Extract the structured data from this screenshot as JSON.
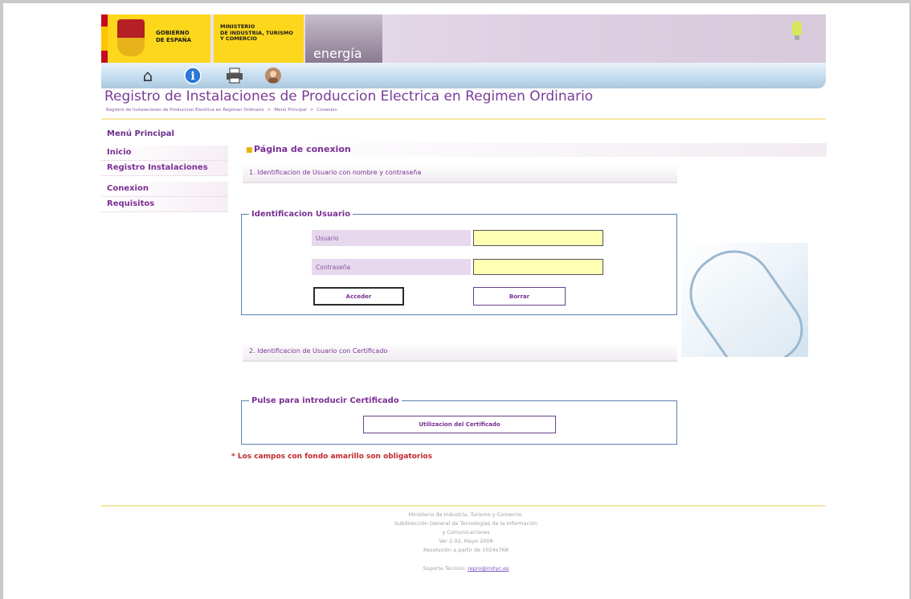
{
  "header": {
    "gobierno_line1": "GOBIERNO",
    "gobierno_line2": "DE ESPAÑA",
    "ministerio_line1": "MINISTERIO",
    "ministerio_line2": "DE INDUSTRIA, TURISMO",
    "ministerio_line3": "Y COMERCIO",
    "energia": "energía"
  },
  "toolbar_icons": [
    "home-icon",
    "info-icon",
    "print-icon",
    "user-photo-icon"
  ],
  "page_title": "Registro de Instalaciones de Produccion Electrica en Regimen Ordinario",
  "breadcrumb": {
    "item1": "Registro de Instalaciones de Produccion Electrica en Regimen Ordinario",
    "item2": "Menú Principal",
    "item3": "Conexion",
    "sep": ">"
  },
  "sidebar": {
    "heading": "Menú Principal",
    "items": [
      "Inicio",
      "Registro Instalaciones",
      "Conexion",
      "Requisitos"
    ]
  },
  "main": {
    "heading": "Página de conexion",
    "section1": "1. Identificacion de Usuario con nombre y contraseña",
    "login_legend": "Identificacion Usuario",
    "user_label": "Usuario",
    "user_value": "",
    "password_label": "Contraseña",
    "password_value": "",
    "login_button": "Acceder",
    "clear_button": "Borrar",
    "section2": "2. Identificacion de Usuario con Certificado",
    "cert_legend": "Pulse para introducir Certificado",
    "cert_button": "Utilizacion del Certificado",
    "required_note": "* Los campos con fondo amarillo son obligatorios"
  },
  "footer": {
    "line1": "Ministerio de Industria, Turismo y Comercio.",
    "line2": "Subdirección General de Tecnologías de la Información",
    "line3": "y Comunicaciones",
    "line4": "Ver 2.02, Mayo 2008",
    "line5": "Resolución a partir de 1024x768",
    "support_label": "Soporte Técnico:",
    "support_email": "repro@mityc.es"
  },
  "colors": {
    "accent_purple": "#7a2f95",
    "required_field": "#ffffb4",
    "label_bg": "#e7d8ee",
    "warning_red": "#c1272d",
    "brand_yellow": "#fcd71b"
  }
}
